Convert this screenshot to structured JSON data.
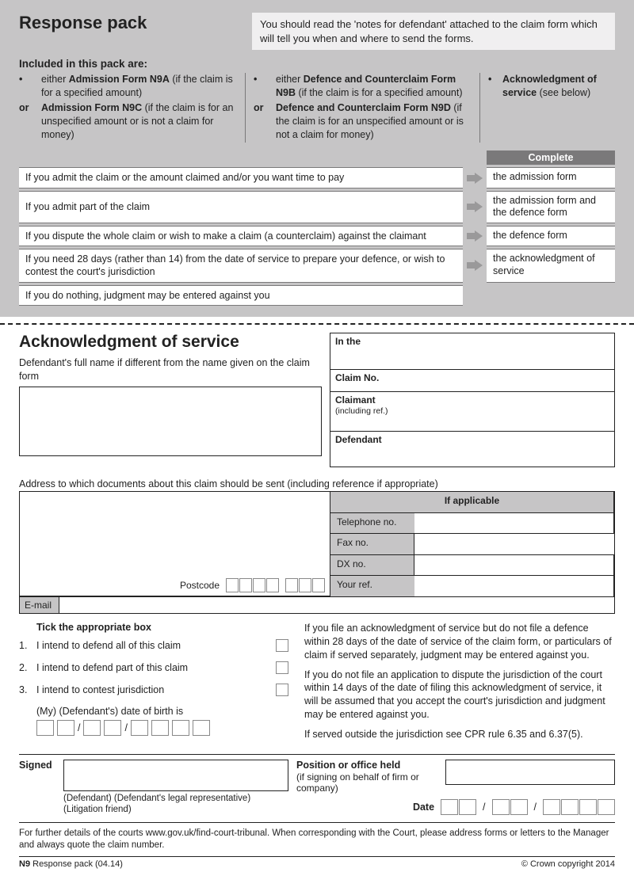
{
  "header": {
    "title": "Response pack",
    "note": "You should read the 'notes for defendant' attached to the claim form which will tell you when and where to send the forms."
  },
  "included": {
    "label": "Included in this pack are:",
    "col1": {
      "a_bullet": "•",
      "a_pre": "either ",
      "a_bold": "Admission Form N9A",
      "a_post": " (if the claim is for a specified amount)",
      "b_bullet": "or",
      "b_bold": "Admission Form N9C",
      "b_post": " (if the claim is for an unspecified amount or is not a claim for money)"
    },
    "col2": {
      "a_bullet": "•",
      "a_pre": "either ",
      "a_bold": "Defence and Counterclaim Form N9B",
      "a_post": " (if the claim is for a specified amount)",
      "b_bullet": "or",
      "b_bold": "Defence and Counterclaim Form N9D",
      "b_post": " (if the claim is for an unspecified amount or is not a claim for money)"
    },
    "col3": {
      "bullet": "•",
      "bold": "Acknowledgment of service",
      "post": " (see below)"
    }
  },
  "grid": {
    "complete": "Complete",
    "rows": [
      {
        "left": "If you admit the claim or the amount claimed and/or you want time to pay",
        "right": "the admission form"
      },
      {
        "left": "If you admit part of the claim",
        "right": "the admission form and the defence form"
      },
      {
        "left": "If you dispute the whole claim or wish to make a claim (a counterclaim) against the claimant",
        "right": "the defence form"
      },
      {
        "left": "If you need 28 days (rather than 14) from the date of service to prepare your defence, or wish to contest the court's jurisdiction",
        "right": "the acknowledgment of service"
      }
    ],
    "last": "If you do nothing, judgment may be entered against you"
  },
  "ack": {
    "title": "Acknowledgment of service",
    "sub": "Defendant's full name if different from the name given on the claim form"
  },
  "case": {
    "in_the": "In the",
    "claim_no": "Claim No.",
    "claimant": "Claimant",
    "claimant_sub": "(including ref.)",
    "defendant": "Defendant"
  },
  "addr": {
    "label": "Address to which documents about this claim should be sent (including reference if appropriate)",
    "postcode": "Postcode",
    "if_applicable": "If applicable",
    "tel": "Telephone no.",
    "fax": "Fax no.",
    "dx": "DX no.",
    "ref": "Your ref.",
    "email": "E-mail"
  },
  "tick": {
    "header": "Tick the appropriate box",
    "items": [
      {
        "num": "1.",
        "text": "I intend to defend all of this claim"
      },
      {
        "num": "2.",
        "text": "I intend to defend part of this claim"
      },
      {
        "num": "3.",
        "text": "I intend to contest jurisdiction"
      }
    ],
    "dob_label": "(My) (Defendant's) date of birth is",
    "paras": [
      "If you file an acknowledgment of service but do not file a defence within 28 days of the date of service of the claim form, or particulars of claim if served separately, judgment may be entered against you.",
      "If you do not file an application to dispute the jurisdiction of the court within 14 days of the date of filing this acknowledgment of service, it will be assumed that you accept the court's jurisdiction and judgment may be entered against you.",
      "If served outside the jurisdiction see CPR rule 6.35 and 6.37(5)."
    ]
  },
  "sign": {
    "signed": "Signed",
    "signed_sub": "(Defendant) (Defendant's legal representative) (Litigation friend)",
    "position": "Position or office held",
    "position_sub": "(if signing on behalf of firm or company)",
    "date": "Date"
  },
  "footer": {
    "note": "For further details of the courts www.gov.uk/find-court-tribunal. When corresponding with the Court, please address forms or letters to the Manager and always quote the claim number.",
    "left_bold": "N9",
    "left_rest": " Response pack (04.14)",
    "right": "© Crown copyright 2014"
  }
}
